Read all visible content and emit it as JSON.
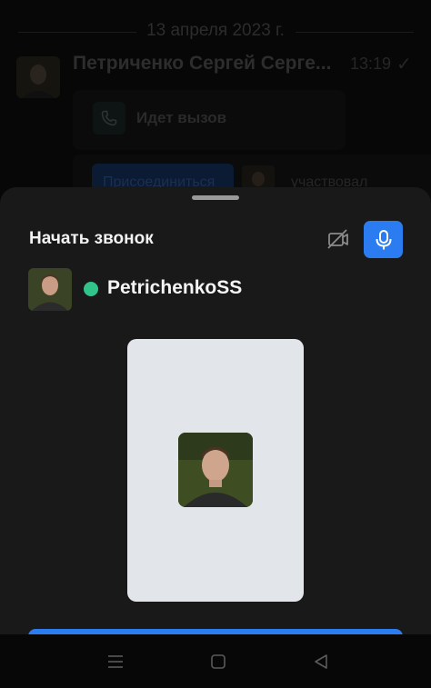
{
  "chat": {
    "date_separator": "13 апреля 2023 г.",
    "message": {
      "sender": "Петриченко Сергей Серге...",
      "time": "13:19",
      "call_status": "Идет вызов",
      "join_label": "Присоединиться",
      "participated_text": "участвовал"
    }
  },
  "sheet": {
    "title": "Начать звонок",
    "user": {
      "name": "PetrichenkoSS",
      "status_color": "#31c48a"
    },
    "accent_color": "#2b7cf0"
  },
  "icons": {
    "camera_off": "video-off-icon",
    "mic": "microphone-icon",
    "phone": "phone-icon",
    "nav_menu": "menu-icon",
    "nav_home": "square-icon",
    "nav_back": "back-triangle-icon"
  }
}
